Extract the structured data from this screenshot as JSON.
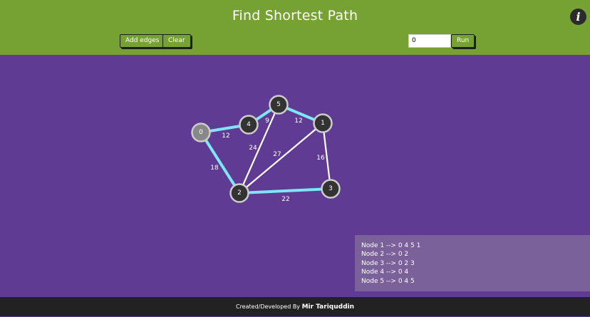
{
  "header": {
    "title": "Find Shortest Path",
    "info_icon": "info-icon",
    "info_glyph": "i",
    "add_edges_label": "Add edges",
    "clear_label": "Clear",
    "source_value": "0",
    "run_label": "Run"
  },
  "colors": {
    "header_bg": "#76a233",
    "canvas_bg": "#5f3b93",
    "path_edge": "#7fe6f5",
    "edge": "#ffffff",
    "node_fill": "#333333",
    "source_node_fill": "#888888",
    "node_stroke": "#cccccc",
    "footer_bg": "#222222"
  },
  "graph": {
    "source": 0,
    "nodes": [
      {
        "id": "0",
        "label": "0"
      },
      {
        "id": "1",
        "label": "1"
      },
      {
        "id": "2",
        "label": "2"
      },
      {
        "id": "3",
        "label": "3"
      },
      {
        "id": "4",
        "label": "4"
      },
      {
        "id": "5",
        "label": "5"
      }
    ],
    "edges": [
      {
        "from": "0",
        "to": "4",
        "weight": "12",
        "in_path": true
      },
      {
        "from": "4",
        "to": "5",
        "weight": "9",
        "in_path": true
      },
      {
        "from": "5",
        "to": "1",
        "weight": "12",
        "in_path": true
      },
      {
        "from": "0",
        "to": "2",
        "weight": "18",
        "in_path": true
      },
      {
        "from": "2",
        "to": "3",
        "weight": "22",
        "in_path": true
      },
      {
        "from": "2",
        "to": "5",
        "weight": "24",
        "in_path": false
      },
      {
        "from": "2",
        "to": "1",
        "weight": "27",
        "in_path": false
      },
      {
        "from": "1",
        "to": "3",
        "weight": "16",
        "in_path": false
      }
    ]
  },
  "results": [
    "Node 1 --> 0 4 5 1",
    "Node 2 --> 0 2",
    "Node 3 --> 0 2 3",
    "Node 4 --> 0 4",
    "Node 5 --> 0 4 5"
  ],
  "footer": {
    "prefix": "Created/Developed By",
    "author": "Mir Tariquddin"
  }
}
